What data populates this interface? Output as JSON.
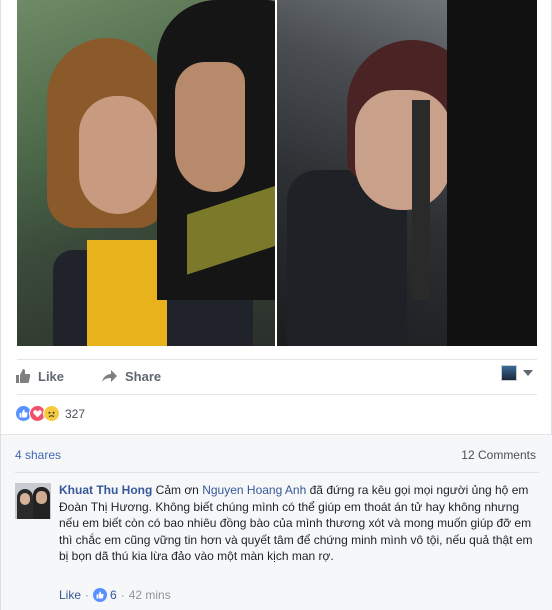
{
  "post": {
    "photo_alt_left": "",
    "photo_alt_right": ""
  },
  "actions": {
    "like_label": "Like",
    "share_label": "Share"
  },
  "reactions": {
    "count": "327",
    "types": [
      "like",
      "love",
      "sad"
    ]
  },
  "stats": {
    "shares": "4 shares",
    "comments": "12 Comments"
  },
  "comment": {
    "author": "Khuat Thu Hong",
    "text_before_mention": " Cảm ơn ",
    "mention": "Nguyen Hoang Anh",
    "text_after_mention": " đã đứng ra kêu gọi mọi người ủng hộ em Đoàn Thị Hương. Không biết chúng mình có thể giúp em thoát án tử hay không nhưng nếu em biết còn có bao nhiêu đồng bào của mình thương xót và mong muốn giúp đỡ em thì chắc em cũng vững tin hơn và quyết tâm để chứng minh mình vô tội, nếu quả thật em bị bọn dã thú kia lừa đảo vào một màn kịch man rợ.",
    "like_label": "Like",
    "reaction_count": "6",
    "time": "42 mins",
    "separator": "·"
  },
  "colors": {
    "link": "#365899",
    "like_blue": "#5890ff",
    "love_red": "#f25268",
    "sad_yellow": "#f7c93d"
  }
}
